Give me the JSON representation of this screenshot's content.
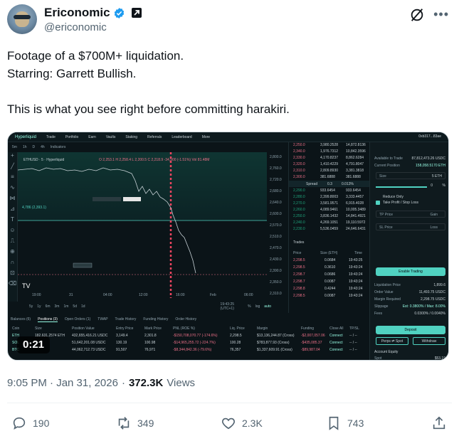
{
  "author": {
    "display_name": "Ericonomic",
    "handle": "@ericonomic"
  },
  "tweet": {
    "line1": "Footage of a $700M+ liquidation.",
    "line2": "Starring: Garrett Bullish.",
    "line3": "This is what you see right before committing harakiri."
  },
  "video": {
    "timestamp": "0:21",
    "app": {
      "logo": "Hyperliquid",
      "nav": [
        "Trade",
        "Portfolio",
        "Earn",
        "Vaults",
        "Staking",
        "Referrals",
        "Leaderboard",
        "More"
      ],
      "wallet": "0xb317...83ae",
      "toolbar": [
        "5m",
        "1h",
        "D",
        "4h",
        "Indicators"
      ],
      "pair_label": "ETHUSD · 5 · Hyperliquid",
      "ohlc": "O 2,253.1 H 2,258.4 L 2,200.5 C 2,218.9 -34,900 (-1.51%) Vol 81.48M",
      "price_axis": [
        "2,800.0",
        "2,760.0",
        "2,720.0",
        "2,680.0",
        "2,640.0",
        "2,600.0",
        "2,570.0",
        "2,510.0",
        "2,470.0",
        "2,430.0",
        "2,390.0",
        "2,350.0",
        "2,310.0"
      ],
      "time_axis": [
        "19:00",
        "31",
        "04:00",
        "12:00",
        "16:00",
        "Feb",
        "06:00"
      ],
      "ranges": [
        "5y",
        "1y",
        "6m",
        "3m",
        "1m",
        "5d",
        "1d"
      ],
      "clock": "19:43:25 (UTC+1)",
      "scale_opts": [
        "%",
        "log",
        "auto"
      ],
      "bottom_tabs": [
        "Balances (6)",
        "Positions (3)",
        "Open Orders (1)",
        "TWAP",
        "Trade History",
        "Funding History",
        "Order History"
      ],
      "positions_headers": [
        "Coin",
        "Size",
        "Position Value",
        "Entry Price",
        "Mark Price",
        "PNL (ROE %)",
        "Liq. Price",
        "Margin",
        "Funding",
        "Close All",
        "TP/SL"
      ],
      "positions": [
        {
          "coin": "ETH",
          "size": "182,631.2574 ETH",
          "value": "432,655,416.21 USDC",
          "entry": "3,149.4",
          "mark": "2,301.8",
          "pnl": "-$150,708,070.77 (-174.6%)",
          "liq": "2,298.5",
          "margin": "$13,136,244.87 (Cross)",
          "funding": "-$2,007,057.06",
          "close": "Connect",
          "tpsl": "-- / --"
        },
        {
          "coin": "SOL",
          "size": "",
          "value": "51,642,201.08 USDC",
          "entry": "130.19",
          "mark": "100.98",
          "pnl": "-$14,965,255.72 (-224.7%)",
          "liq": "100.28",
          "margin": "$783,877.93 (Cross)",
          "funding": "-$435,085.37",
          "close": "Connect",
          "tpsl": "-- / --"
        },
        {
          "coin": "BTC",
          "size": "",
          "value": "44,062,712.73 USDC",
          "entry": "91,507",
          "mark": "76,971",
          "pnl": "-$8,344,842.36 (-79.6%)",
          "liq": "76,357",
          "margin": "$1,337,609.91 (Cross)",
          "funding": "-$89,987.04",
          "close": "Connect",
          "tpsl": "-- / --"
        }
      ],
      "book_asks": [
        [
          "2,250.0",
          "3,980.2528",
          "14,872.8136"
        ],
        [
          "2,340.0",
          "1,976.7312",
          "10,842.3596"
        ],
        [
          "2,330.0",
          "4,170.8237",
          "8,862.6284"
        ],
        [
          "2,320.0",
          "1,410.4229",
          "4,791.8047"
        ],
        [
          "2,310.0",
          "2,809.8930",
          "3,381.3818"
        ],
        [
          "2,300.0",
          "381.6888",
          "381.6888"
        ]
      ],
      "spread": [
        "Spread",
        "0.3",
        "0.013%"
      ],
      "book_bids": [
        [
          "2,290.0",
          "933.6454",
          "933.6454"
        ],
        [
          "2,280.0",
          "2,399.8003",
          "3,333.4457"
        ],
        [
          "2,270.0",
          "3,581.9571",
          "6,915.4028"
        ],
        [
          "2,260.0",
          "4,089.9461",
          "10,005.3489"
        ],
        [
          "2,250.0",
          "3,836.1432",
          "14,841.4921"
        ],
        [
          "2,240.0",
          "4,269.1051",
          "19,110.5972"
        ],
        [
          "2,230.0",
          "5,536.0459",
          "24,646.6431"
        ]
      ],
      "trades_title": "Trades",
      "trades_headers": [
        "Price",
        "Size (ETH)",
        "Time"
      ],
      "trades": [
        [
          "2,298.5",
          "0.0684",
          "19:43:25"
        ],
        [
          "2,298.5",
          "0.3610",
          "19:43:24"
        ],
        [
          "2,298.7",
          "0.0686",
          "19:43:24"
        ],
        [
          "2,298.7",
          "0.0087",
          "19:43:24"
        ],
        [
          "2,298.8",
          "0.4244",
          "19:43:24"
        ],
        [
          "2,298.5",
          "0.0087",
          "19:43:24"
        ]
      ],
      "panel": {
        "avail_label": "Available to Trade",
        "avail_val": "87,812,473.26 USDC",
        "curpos_label": "Current Position",
        "curpos_val": "158,058.5170 ETH",
        "size_label": "Size",
        "size_unit": "5 ETH",
        "pct": "0",
        "pct_unit": "%",
        "reduce_only": "Reduce Only",
        "tpsl": "Take Profit / Stop Loss",
        "tp_label": "TP Price",
        "tp_sel": "Gain",
        "sl_label": "SL Price",
        "sl_sel": "Loss",
        "enable": "Enable Trading",
        "rows": [
          [
            "Liquidation Price",
            "1,899.6"
          ],
          [
            "Order Value",
            "11,493.75 USDC"
          ],
          [
            "Margin Required",
            "2,298.75 USDC"
          ],
          [
            "Slippage",
            "Est: 0.3800% / Max: 8.00%"
          ],
          [
            "Fees",
            "0.0300% / 0.0040%"
          ]
        ],
        "deposit": "Deposit",
        "perps_spot": "Perps ⇄ Spot",
        "withdraw": "Withdraw",
        "equity": "Account Equity",
        "spot_label": "Spot",
        "spot_val": "$53.19"
      }
    }
  },
  "meta": {
    "time": "9:05 PM · Jan 31, 2026",
    "sep": "·",
    "views": "372.3K",
    "views_label": "Views"
  },
  "actions": {
    "replies": "190",
    "reposts": "349",
    "likes": "2.3K",
    "bookmarks": "743"
  },
  "colors": {
    "accent_teal": "#97fce4",
    "loss_red": "#ed7088",
    "gain_green": "#1fa67d",
    "x_blue": "#1d9bf0"
  }
}
